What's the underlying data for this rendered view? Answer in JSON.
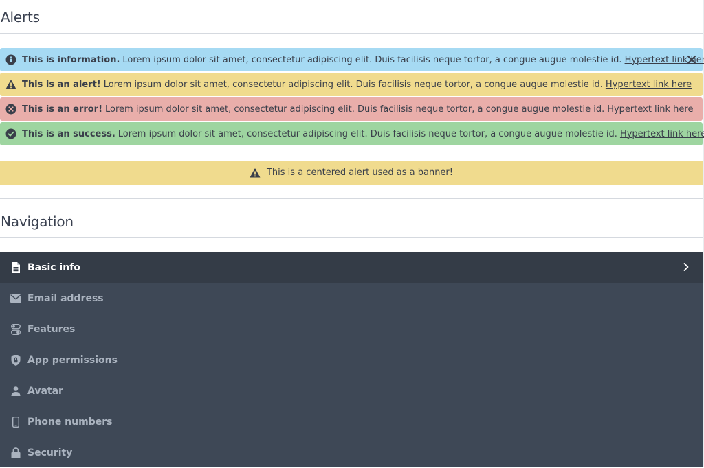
{
  "alerts_section": {
    "title": "Alerts"
  },
  "alerts": [
    {
      "type": "info",
      "icon": "info-circle-icon",
      "title": "This is information.",
      "message": "Lorem ipsum dolor sit amet, consectetur adipiscing elit. Duis facilisis neque tortor, a congue augue molestie id.",
      "link": "Hypertext link here.",
      "dismissible": true,
      "color": "#a6daf3"
    },
    {
      "type": "warning",
      "icon": "warning-triangle-icon",
      "title": "This is an alert!",
      "message": "Lorem ipsum dolor sit amet, consectetur adipiscing elit. Duis facilisis neque tortor, a congue augue molestie id.",
      "link": "Hypertext link here",
      "color": "#f0db8e"
    },
    {
      "type": "error",
      "icon": "error-circle-icon",
      "title": "This is an error!",
      "message": "Lorem ipsum dolor sit amet, consectetur adipiscing elit. Duis facilisis neque tortor, a congue augue molestie id.",
      "link": "Hypertext link here",
      "color": "#e9aeaa"
    },
    {
      "type": "success",
      "icon": "check-circle-icon",
      "title": "This is an success.",
      "message": "Lorem ipsum dolor sit amet, consectetur adipiscing elit. Duis facilisis neque tortor, a congue augue molestie id.",
      "link": "Hypertext link here",
      "color": "#9ed5a0"
    }
  ],
  "banner": {
    "icon": "warning-triangle-icon",
    "text": "This is a centered alert used as a banner!"
  },
  "navigation_section": {
    "title": "Navigation"
  },
  "navigation": {
    "items": [
      {
        "label": "Basic info",
        "icon": "document-icon",
        "active": true
      },
      {
        "label": "Email address",
        "icon": "envelope-icon"
      },
      {
        "label": "Features",
        "icon": "toggles-icon"
      },
      {
        "label": "App permissions",
        "icon": "shield-lock-icon"
      },
      {
        "label": "Avatar",
        "icon": "user-icon"
      },
      {
        "label": "Phone numbers",
        "icon": "phone-icon"
      },
      {
        "label": "Security",
        "icon": "lock-icon"
      }
    ],
    "background": "#3e4856",
    "active_background": "#343c47"
  }
}
